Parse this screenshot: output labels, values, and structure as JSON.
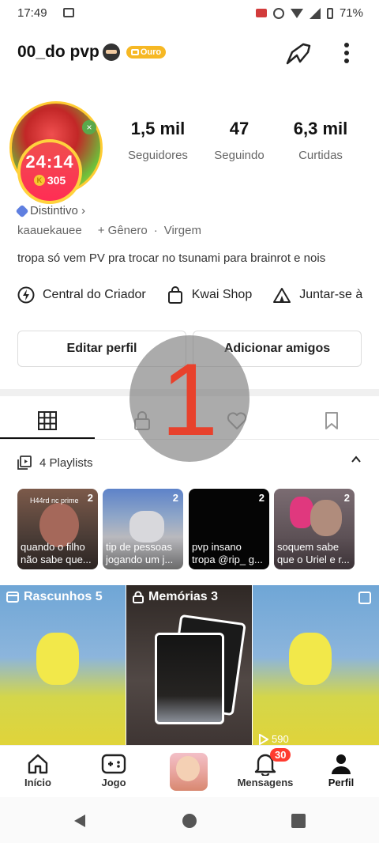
{
  "status_bar": {
    "time": "17:49",
    "battery": "71%"
  },
  "header": {
    "username": "00_do pvp",
    "badge": "Ouro"
  },
  "profile": {
    "live_timer": "24:14",
    "coins": "305",
    "stats": [
      {
        "value": "1,5 mil",
        "label": "Seguidores"
      },
      {
        "value": "47",
        "label": "Seguindo"
      },
      {
        "value": "6,3 mil",
        "label": "Curtidas"
      }
    ],
    "distintivo": "Distintivo ›",
    "handle": "kaauekauee",
    "gender": "+ Gênero",
    "dot": "·",
    "sign": "Virgem",
    "bio": "tropa só vem PV pra trocar no tsunami para brainrot e nois"
  },
  "shortcuts": [
    {
      "label": "Central do Criador",
      "icon": "lightning-icon"
    },
    {
      "label": "Kwai Shop",
      "icon": "shopping-bag-icon"
    },
    {
      "label": "Juntar-se à",
      "icon": "tent-icon"
    }
  ],
  "buttons": {
    "edit": "Editar perfil",
    "add_friends": "Adicionar amigos"
  },
  "overlay_number": "1",
  "playlists": {
    "title": "4 Playlists",
    "items": [
      {
        "count": "2",
        "caption": "quando o filho não sabe que...",
        "tag": "H44rd nc prime"
      },
      {
        "count": "2",
        "caption": "tip de pessoas jogando um j..."
      },
      {
        "count": "2",
        "caption": "pvp insano tropa @rip_ g..."
      },
      {
        "count": "2",
        "caption": "soquem sabe que o Uriel e r..."
      }
    ]
  },
  "grid": {
    "drafts": "Rascunhos 5",
    "memories": "Memórias 3",
    "views": "590"
  },
  "nav": {
    "home": "Início",
    "game": "Jogo",
    "messages": "Mensagens",
    "messages_badge": "30",
    "profile": "Perfil"
  },
  "colors": {
    "accent_red": "#ff3b30",
    "badge_gold": "#f6b824",
    "overlay_digit": "#e8412c"
  }
}
